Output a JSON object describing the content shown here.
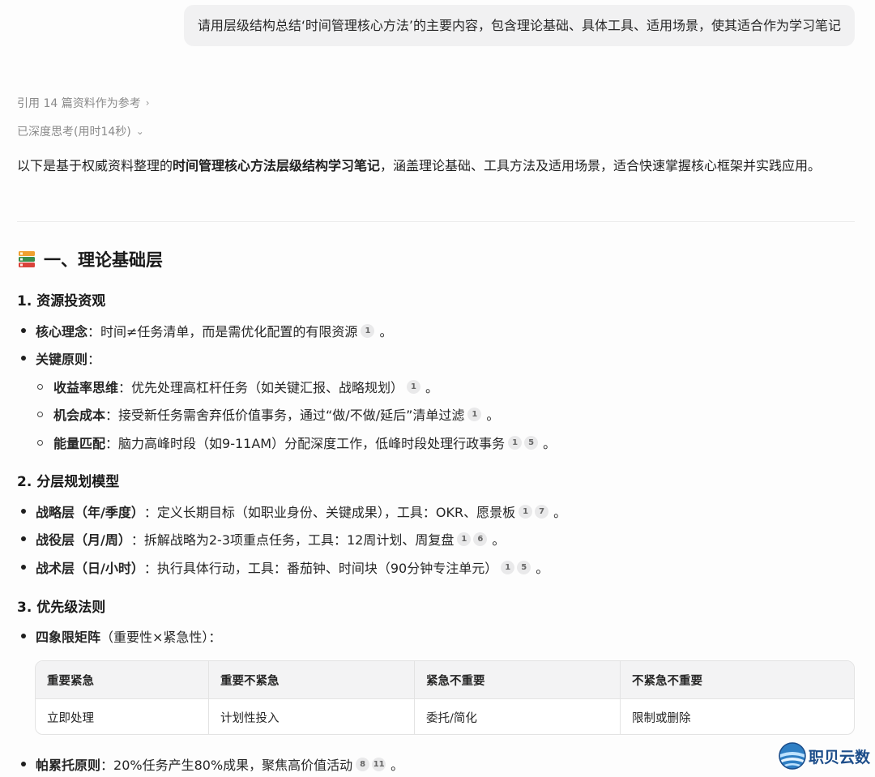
{
  "user_message": "请用层级结构总结‘时间管理核心方法’的主要内容，包含理论基础、具体工具、适用场景，使其适合作为学习笔记",
  "refs_label": "引用 14 篇资料作为参考",
  "deep_think_label": "已深度思考(用时14秒)",
  "intro": {
    "pre": "以下是基于权威资料整理的",
    "bold": "时间管理核心方法层级结构学习笔记",
    "post": "，涵盖理论基础、工具方法及适用场景，适合快速掌握核心框架并实践应用。"
  },
  "section1": {
    "title": "一、理论基础层",
    "icon": "books-icon",
    "sub1": {
      "title": "1. 资源投资观",
      "item1": {
        "label": "核心理念",
        "text": "：时间≠任务清单，而是需优化配置的有限资源",
        "cites": [
          "1"
        ],
        "end": "。"
      },
      "item2": {
        "label": "关键原则",
        "text": "："
      },
      "children": [
        {
          "label": "收益率思维",
          "text": "：优先处理高杠杆任务（如关键汇报、战略规划）",
          "cites": [
            "1"
          ],
          "end": "。"
        },
        {
          "label": "机会成本",
          "text": "：接受新任务需舍弃低价值事务，通过“做/不做/延后”清单过滤",
          "cites": [
            "1"
          ],
          "end": "。"
        },
        {
          "label": "能量匹配",
          "text": "：脑力高峰时段（如9-11AM）分配深度工作，低峰时段处理行政事务",
          "cites": [
            "1",
            "5"
          ],
          "end": "。"
        }
      ]
    },
    "sub2": {
      "title": "2. 分层规划模型",
      "items": [
        {
          "label": "战略层（年/季度）",
          "text": "：定义长期目标（如职业身份、关键成果），工具：OKR、愿景板",
          "cites": [
            "1",
            "7"
          ],
          "end": "。"
        },
        {
          "label": "战役层（月/周）",
          "text": "：拆解战略为2-3项重点任务，工具：12周计划、周复盘",
          "cites": [
            "1",
            "6"
          ],
          "end": "。"
        },
        {
          "label": "战术层（日/小时）",
          "text": "：执行具体行动，工具：番茄钟、时间块（90分钟专注单元）",
          "cites": [
            "1",
            "5"
          ],
          "end": "。"
        }
      ]
    },
    "sub3": {
      "title": "3. 优先级法则",
      "matrix": {
        "label": "四象限矩阵",
        "text": "（重要性×紧急性）："
      },
      "table": {
        "headers": [
          "重要紧急",
          "重要不紧急",
          "紧急不重要",
          "不紧急不重要"
        ],
        "row": [
          "立即处理",
          "计划性投入",
          "委托/简化",
          "限制或删除"
        ]
      },
      "pareto": {
        "label": "帕累托原则",
        "text": "：20%任务产生80%成果，聚焦高价值活动",
        "cites": [
          "8",
          "11"
        ],
        "end": "。"
      }
    }
  },
  "watermark": "职贝云数",
  "colors": {
    "bubble_bg": "#f1f1f2",
    "cite_bg": "#e9e9ea",
    "table_head_bg": "#f3f3f4",
    "logo_text": "#1c4d8a"
  }
}
